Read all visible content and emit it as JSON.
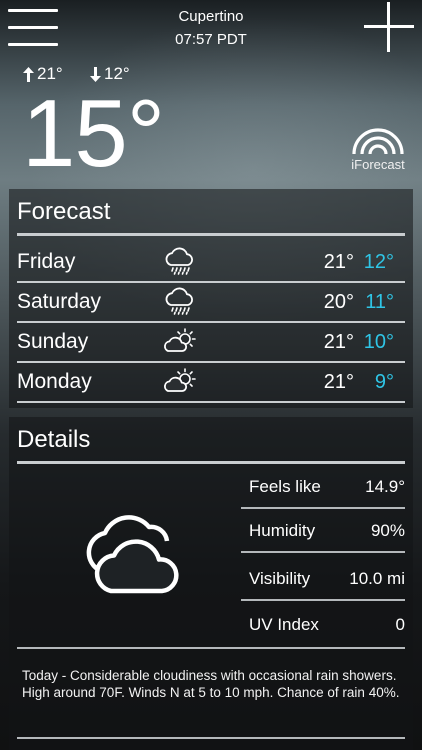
{
  "header": {
    "city": "Cupertino",
    "time": "07:57 PDT"
  },
  "current": {
    "high": "21°",
    "low": "12°",
    "temperature": "15°",
    "brand": "iForecast"
  },
  "forecast": {
    "title": "Forecast",
    "days": [
      {
        "day": "Friday",
        "icon": "cloud-rain-icon",
        "high": "21°",
        "low": "12°"
      },
      {
        "day": "Saturday",
        "icon": "cloud-rain-icon",
        "high": "20°",
        "low": "11°"
      },
      {
        "day": "Sunday",
        "icon": "partly-sunny-icon",
        "high": "21°",
        "low": "10°"
      },
      {
        "day": "Monday",
        "icon": "partly-sunny-icon",
        "high": "21°",
        "low": "9°"
      }
    ]
  },
  "details": {
    "title": "Details",
    "icon": "cloudy-icon",
    "items": [
      {
        "label": "Feels like",
        "value": "14.9°"
      },
      {
        "label": "Humidity",
        "value": "90%"
      },
      {
        "label": "Visibility",
        "value": "10.0 mi"
      },
      {
        "label": "UV Index",
        "value": "0"
      }
    ],
    "summary": "Today - Considerable cloudiness with occasional rain showers. High around 70F. Winds N at 5 to 10 mph. Chance of rain 40%."
  },
  "colors": {
    "accent_low": "#2fc5e6",
    "text": "#ffffff",
    "rule": "#c9cdd0"
  }
}
